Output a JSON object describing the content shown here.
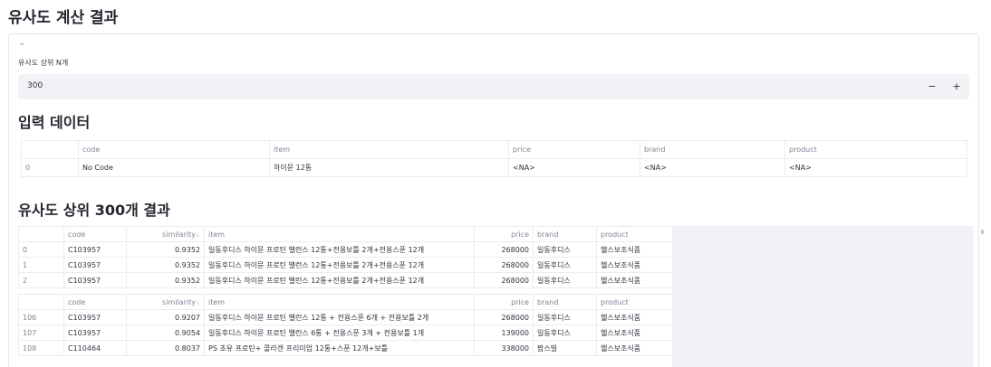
{
  "page": {
    "title": "유사도 계산 결과"
  },
  "expander": {
    "toggle": "–"
  },
  "topn": {
    "label": "유사도 상위 N개",
    "value": "300",
    "minus": "−",
    "plus": "+"
  },
  "input_section": {
    "title": "입력 데이터",
    "columns": [
      "",
      "code",
      "item",
      "price",
      "brand",
      "product"
    ],
    "rows": [
      [
        "0",
        "No Code",
        "하이뮨 12통",
        "<NA>",
        "<NA>",
        "<NA>"
      ]
    ]
  },
  "result_section": {
    "title": "유사도 상위 300개 결과",
    "columns": [
      "",
      "code",
      "similarity",
      "item",
      "price",
      "brand",
      "product"
    ],
    "sort_indicator": "↓",
    "top_rows": [
      [
        "0",
        "C103957",
        "0.9352",
        "일동후디스 하이뮨 프로틴 밸런스 12통+전용보틀 2개+전용스푼 12개",
        "268000",
        "일동후디스",
        "헬스보조식품"
      ],
      [
        "1",
        "C103957",
        "0.9352",
        "일동후디스 하이뮨 프로틴 밸런스 12통+전용보틀 2개+전용스푼 12개",
        "268000",
        "일동후디스",
        "헬스보조식품"
      ],
      [
        "2",
        "C103957",
        "0.9352",
        "일동후디스 하이뮨 프로틴 밸런스 12통+전용보틀 2개+전용스푼 12개",
        "268000",
        "일동후디스",
        "헬스보조식품"
      ]
    ],
    "bottom_rows": [
      [
        "106",
        "C103957",
        "0.9207",
        "일동후디스 하이뮨 프로틴 밸런스 12통 + 전용스푼 6개 + 전용보틀 2개",
        "268000",
        "일동후디스",
        "헬스보조식품"
      ],
      [
        "107",
        "C103957",
        "0.9054",
        "일동후디스 하이뮨 프로틴 밸런스 6통 + 전용스푼 3개 + 전용보틀 1개",
        "139000",
        "일동후디스",
        "헬스보조식품"
      ],
      [
        "108",
        "C110464",
        "0.8037",
        "PS 초유 프로틴+ 콜라겐 프리미엄 12통+스푼 12개+보틀",
        "338000",
        "팜스빌",
        "헬스보조식품"
      ]
    ]
  }
}
